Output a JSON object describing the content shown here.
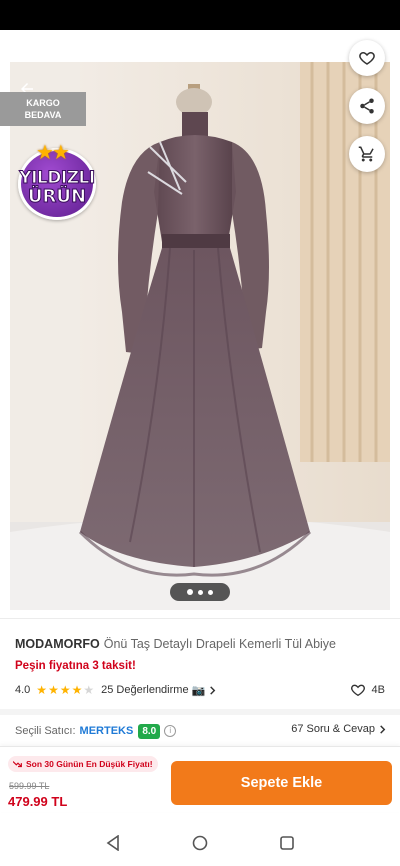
{
  "badges": {
    "kargo_line1": "KARGO",
    "kargo_line2": "BEDAVA",
    "yildizli_line1": "YILDIZLI",
    "yildizli_line2": "ÜRÜN"
  },
  "product": {
    "brand": "MODAMORFO",
    "name": "Önü Taş Detaylı Drapeli Kemerli Tül Abiye",
    "installment": "Peşin fiyatına 3 taksit!",
    "rating": "4.0",
    "rating_stars": 4,
    "reviews": "25 Değerlendirme",
    "favorites": "4B"
  },
  "seller": {
    "label": "Seçili Satıcı:",
    "name": "MERTEKS",
    "score": "8.0",
    "qa": "67 Soru & Cevap"
  },
  "pricing": {
    "lowest_badge": "Son 30 Günün En Düşük Fiyatı!",
    "old_price": "599.99 TL",
    "new_price": "479.99 TL",
    "cart_button": "Sepete Ekle"
  },
  "gallery": {
    "image_count": 3,
    "active_index": 0
  },
  "icons": {
    "back": "back-arrow-icon",
    "favorite": "heart-icon",
    "share": "share-icon",
    "cart": "cart-icon",
    "camera": "camera-icon"
  },
  "colors": {
    "brand_orange": "#f27a1a",
    "price_red": "#d0021b",
    "seller_blue": "#1f7ad6",
    "score_green": "#22a94a",
    "star_yellow": "#ffb300"
  }
}
